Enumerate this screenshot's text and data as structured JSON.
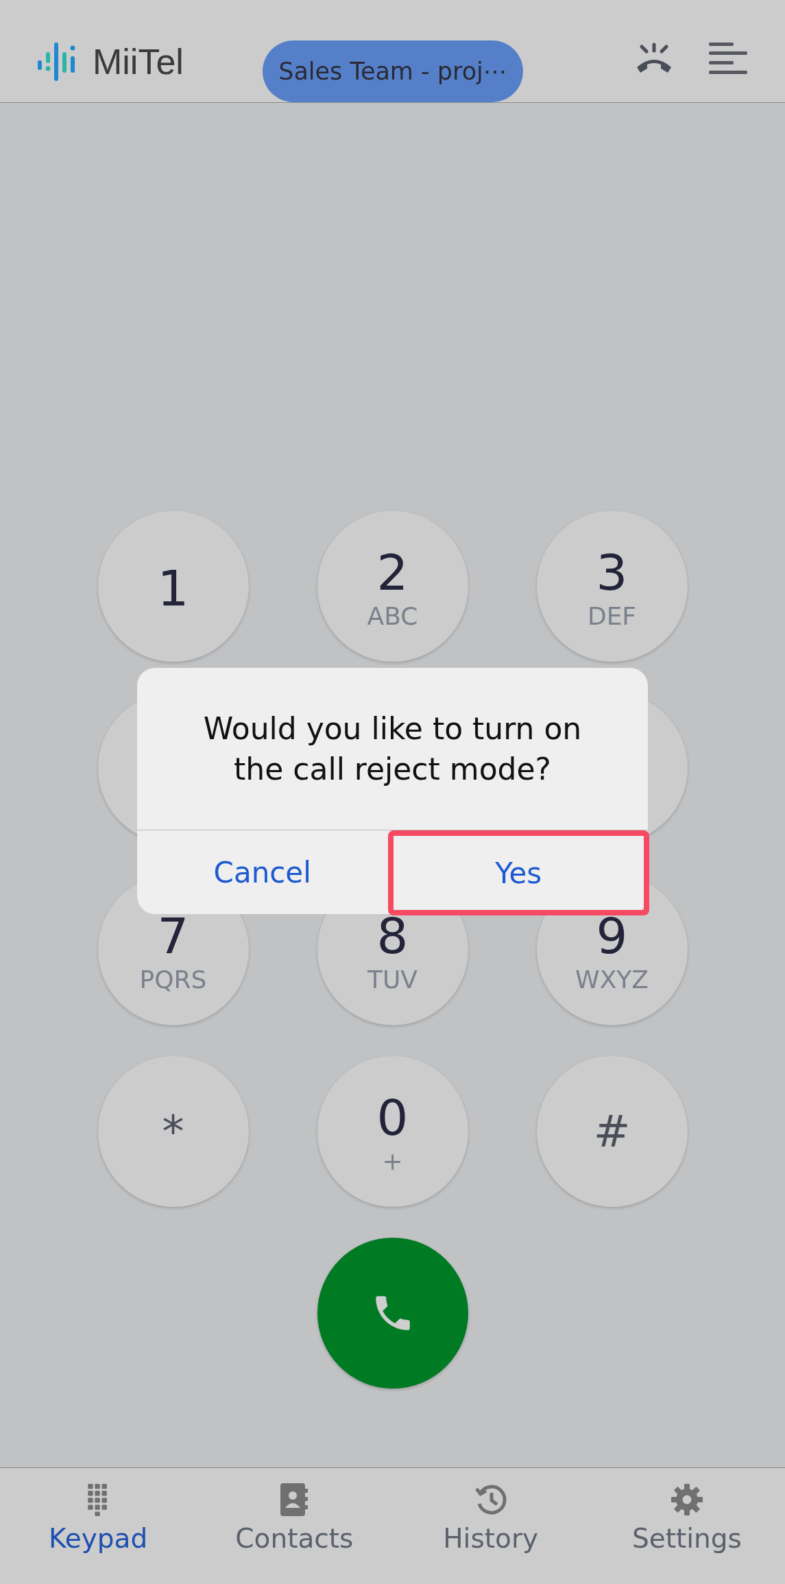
{
  "header": {
    "logo": "MiiTel",
    "team": "Sales Team - proj⋯"
  },
  "keys": [
    {
      "kind": "digit",
      "digit": "1"
    },
    {
      "kind": "digit",
      "digit": "2",
      "letters": "ABC"
    },
    {
      "kind": "digit",
      "digit": "3",
      "letters": "DEF"
    },
    {
      "kind": "covered"
    },
    {
      "kind": "covered"
    },
    {
      "kind": "digit",
      "digit": "7",
      "letters": "PQRS"
    },
    {
      "kind": "digit",
      "digit": "8",
      "letters": "TUV"
    },
    {
      "kind": "digit",
      "digit": "9",
      "letters": "WXYZ"
    },
    {
      "kind": "symbol",
      "digit": "*"
    },
    {
      "kind": "digit",
      "digit": "0",
      "letters": "+"
    },
    {
      "kind": "symbol",
      "digit": "#"
    }
  ],
  "dialog": {
    "message": "Would you like to turn on the call reject mode?",
    "buttons": [
      {
        "label": "Cancel",
        "highlighted": false
      },
      {
        "label": "Yes",
        "highlighted": true
      }
    ]
  },
  "nav": [
    {
      "kind": "keypad",
      "label": "Keypad",
      "selected": true
    },
    {
      "kind": "contacts",
      "label": "Contacts",
      "selected": false
    },
    {
      "kind": "history",
      "label": "History",
      "selected": false
    },
    {
      "kind": "settings",
      "label": "Settings",
      "selected": false
    }
  ]
}
